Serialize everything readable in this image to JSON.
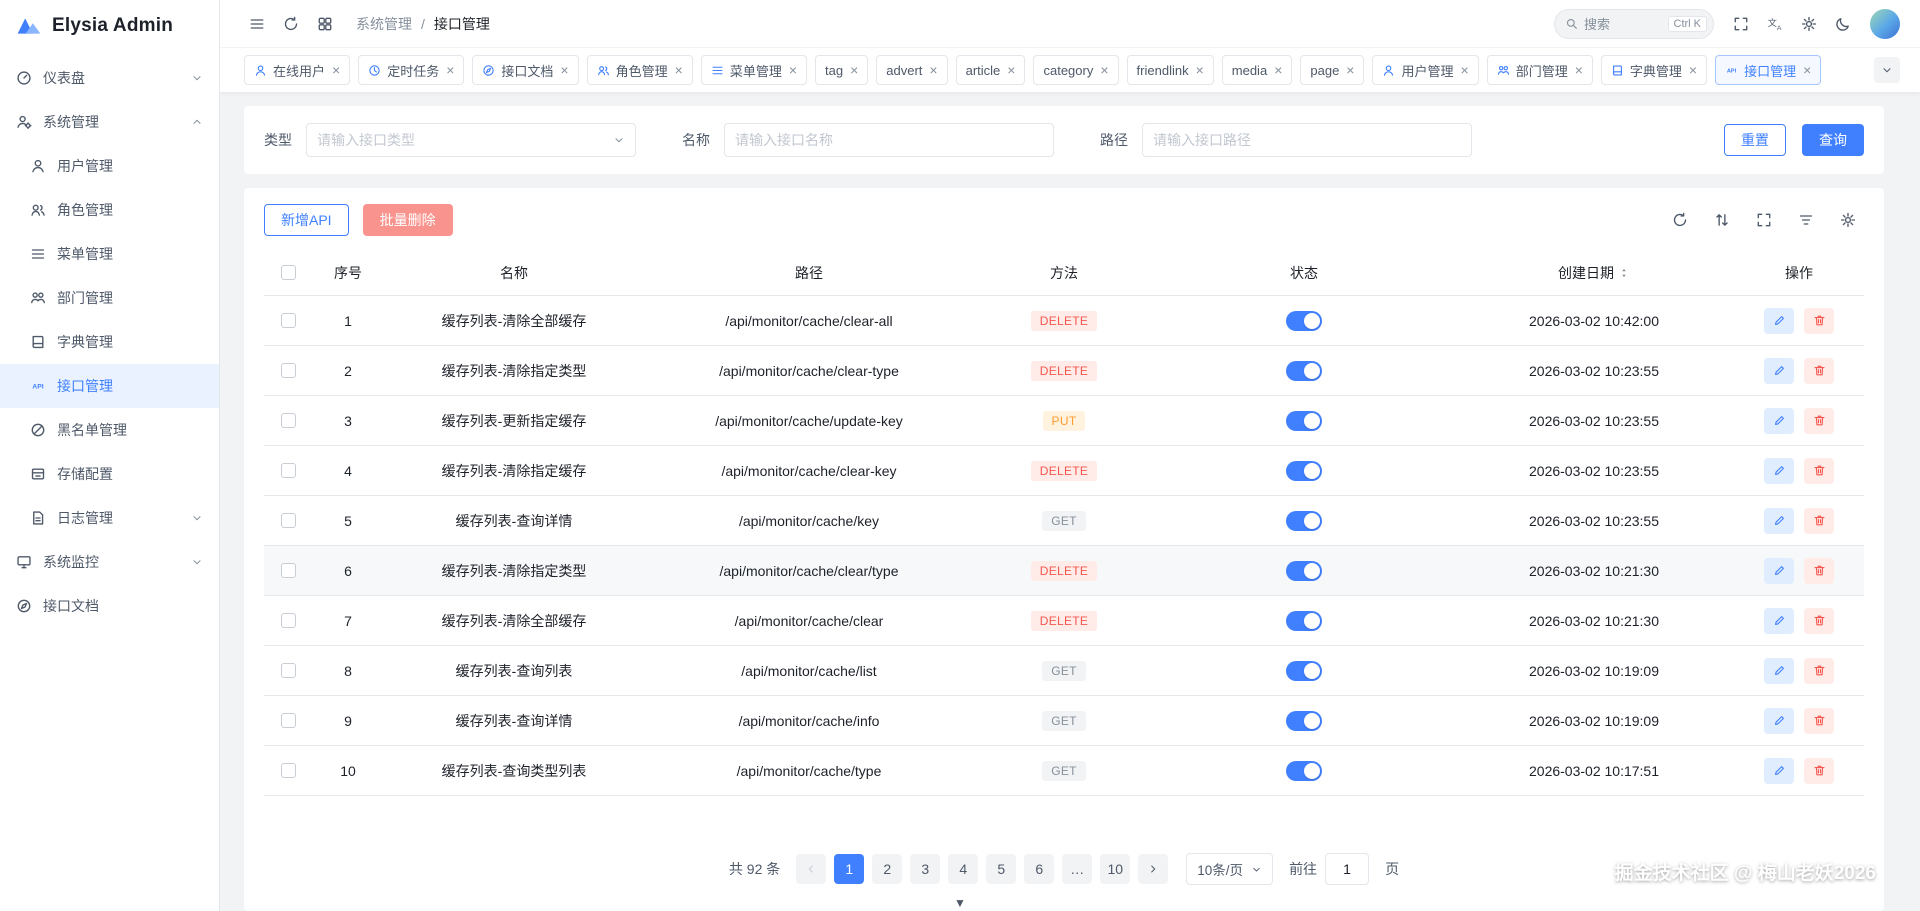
{
  "app": {
    "title": "Elysia Admin"
  },
  "header": {
    "left_icons": [
      "menu",
      "refresh",
      "apps"
    ],
    "breadcrumb": [
      "系统管理",
      "接口管理"
    ],
    "breadcrumb_separator": "/",
    "search": {
      "placeholder": "搜索",
      "shortcut": "Ctrl K"
    },
    "right_icons": [
      "fullscreen",
      "translate",
      "settings",
      "moon"
    ]
  },
  "tabs": [
    {
      "label": "在线用户",
      "icon": "person",
      "closable": true
    },
    {
      "label": "定时任务",
      "icon": "clock",
      "closable": true
    },
    {
      "label": "接口文档",
      "icon": "compass",
      "closable": true
    },
    {
      "label": "角色管理",
      "icon": "people",
      "closable": true
    },
    {
      "label": "菜单管理",
      "icon": "list",
      "closable": true
    },
    {
      "label": "tag",
      "closable": true
    },
    {
      "label": "advert",
      "closable": true
    },
    {
      "label": "article",
      "closable": true
    },
    {
      "label": "category",
      "closable": true
    },
    {
      "label": "friendlink",
      "closable": true
    },
    {
      "label": "media",
      "closable": true
    },
    {
      "label": "page",
      "closable": true
    },
    {
      "label": "用户管理",
      "icon": "person",
      "closable": true
    },
    {
      "label": "部门管理",
      "icon": "org",
      "closable": true
    },
    {
      "label": "字典管理",
      "icon": "book",
      "closable": true
    },
    {
      "label": "接口管理",
      "icon": "api",
      "closable": true,
      "active": true
    }
  ],
  "sidebar": {
    "items": [
      {
        "label": "仪表盘",
        "icon": "gauge",
        "chevron": "down"
      },
      {
        "label": "系统管理",
        "icon": "system",
        "chevron": "up"
      },
      {
        "label": "用户管理",
        "icon": "person",
        "child": true
      },
      {
        "label": "角色管理",
        "icon": "people",
        "child": true
      },
      {
        "label": "菜单管理",
        "icon": "list",
        "child": true
      },
      {
        "label": "部门管理",
        "icon": "org",
        "child": true
      },
      {
        "label": "字典管理",
        "icon": "book",
        "child": true
      },
      {
        "label": "接口管理",
        "icon": "api",
        "child": true,
        "active": true
      },
      {
        "label": "黑名单管理",
        "icon": "prohibit",
        "child": true
      },
      {
        "label": "存储配置",
        "icon": "storage",
        "child": true
      },
      {
        "label": "日志管理",
        "icon": "doc",
        "child": true,
        "chevron": "down"
      },
      {
        "label": "系统监控",
        "icon": "monitor",
        "chevron": "down"
      },
      {
        "label": "接口文档",
        "icon": "compass"
      }
    ]
  },
  "filters": {
    "type_label": "类型",
    "type_placeholder": "请输入接口类型",
    "name_label": "名称",
    "name_placeholder": "请输入接口名称",
    "path_label": "路径",
    "path_placeholder": "请输入接口路径",
    "reset_label": "重置",
    "query_label": "查询"
  },
  "toolbar": {
    "add_label": "新增API",
    "batch_delete_label": "批量删除",
    "icons": [
      "refresh",
      "sort",
      "fullscreen",
      "align",
      "settings"
    ]
  },
  "table": {
    "columns": [
      "序号",
      "名称",
      "路径",
      "方法",
      "状态",
      "创建日期",
      "操作"
    ],
    "sort_column": "创建日期",
    "rows": [
      {
        "no": "1",
        "name": "缓存列表-清除全部缓存",
        "path": "/api/monitor/cache/clear-all",
        "method": "DELETE",
        "status": true,
        "date": "2026-03-02 10:42:00"
      },
      {
        "no": "2",
        "name": "缓存列表-清除指定类型",
        "path": "/api/monitor/cache/clear-type",
        "method": "DELETE",
        "status": true,
        "date": "2026-03-02 10:23:55"
      },
      {
        "no": "3",
        "name": "缓存列表-更新指定缓存",
        "path": "/api/monitor/cache/update-key",
        "method": "PUT",
        "status": true,
        "date": "2026-03-02 10:23:55"
      },
      {
        "no": "4",
        "name": "缓存列表-清除指定缓存",
        "path": "/api/monitor/cache/clear-key",
        "method": "DELETE",
        "status": true,
        "date": "2026-03-02 10:23:55"
      },
      {
        "no": "5",
        "name": "缓存列表-查询详情",
        "path": "/api/monitor/cache/key",
        "method": "GET",
        "status": true,
        "date": "2026-03-02 10:23:55"
      },
      {
        "no": "6",
        "name": "缓存列表-清除指定类型",
        "path": "/api/monitor/cache/clear/type",
        "method": "DELETE",
        "status": true,
        "date": "2026-03-02 10:21:30",
        "highlight": true
      },
      {
        "no": "7",
        "name": "缓存列表-清除全部缓存",
        "path": "/api/monitor/cache/clear",
        "method": "DELETE",
        "status": true,
        "date": "2026-03-02 10:21:30"
      },
      {
        "no": "8",
        "name": "缓存列表-查询列表",
        "path": "/api/monitor/cache/list",
        "method": "GET",
        "status": true,
        "date": "2026-03-02 10:19:09"
      },
      {
        "no": "9",
        "name": "缓存列表-查询详情",
        "path": "/api/monitor/cache/info",
        "method": "GET",
        "status": true,
        "date": "2026-03-02 10:19:09"
      },
      {
        "no": "10",
        "name": "缓存列表-查询类型列表",
        "path": "/api/monitor/cache/type",
        "method": "GET",
        "status": true,
        "date": "2026-03-02 10:17:51"
      }
    ]
  },
  "pagination": {
    "total_text": "共 92 条",
    "pages": [
      "1",
      "2",
      "3",
      "4",
      "5",
      "6",
      "…",
      "10"
    ],
    "active_page": "1",
    "page_size": "10条/页",
    "goto_label": "前往",
    "goto_value": "1",
    "goto_suffix": "页"
  },
  "watermark": "掘金技术社区 @ 梅山老妖2026",
  "scroll_hint": "▼",
  "colors": {
    "primary": "#4080ff",
    "danger": "#f5564e",
    "warning": "#ff9a2e",
    "badge_get": "#86909c"
  }
}
